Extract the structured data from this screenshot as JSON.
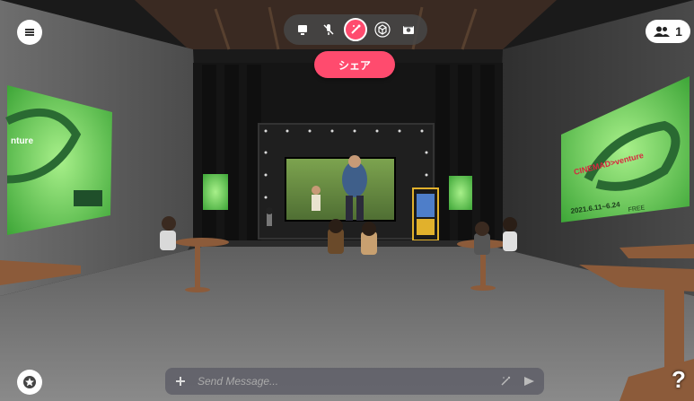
{
  "toolbar": {
    "buttons": [
      {
        "icon": "screen-icon"
      },
      {
        "icon": "mic-muted-icon"
      },
      {
        "icon": "emote-wand-icon",
        "active": true
      },
      {
        "icon": "cube-icon"
      },
      {
        "icon": "camera-icon"
      }
    ]
  },
  "share_button": {
    "label": "シェア"
  },
  "users": {
    "count": "1",
    "icon": "users-icon"
  },
  "menu": {
    "icon": "hamburger-icon"
  },
  "favorite": {
    "icon": "star-icon"
  },
  "help": {
    "label": "?"
  },
  "chat": {
    "add_icon": "plus-icon",
    "placeholder": "Send Message...",
    "emote_icon": "wand-icon",
    "send_icon": "send-icon"
  },
  "scene": {
    "left_banner": {
      "logo_text": "nture"
    },
    "right_banner": {
      "logo_text": "CINEMAD>venture",
      "date_text": "2021.6.11~6.24",
      "sub_text": "FREE"
    },
    "colors": {
      "accent": "#ff4b6e",
      "banner_green": "#6fd25e",
      "floor": "#707070"
    }
  }
}
